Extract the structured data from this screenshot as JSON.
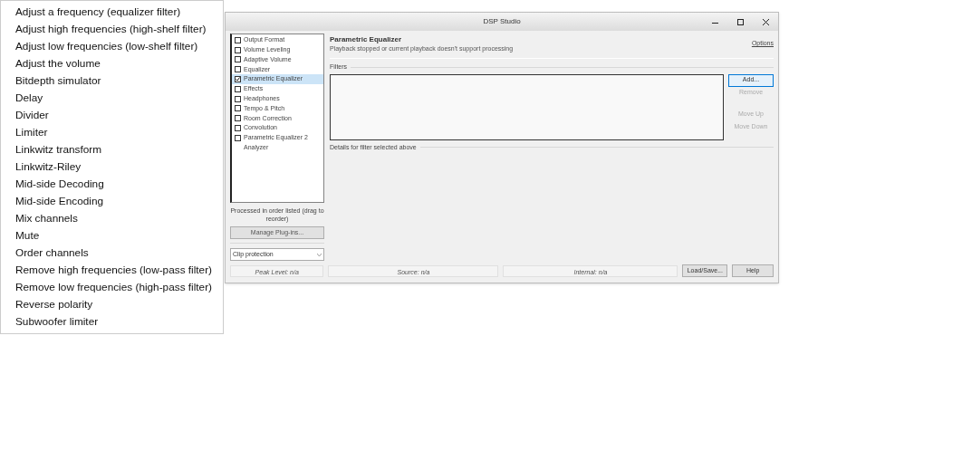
{
  "context_menu": {
    "items": [
      {
        "label": "Adjust a frequency (equalizer filter)"
      },
      {
        "label": "Adjust high frequencies (high-shelf filter)"
      },
      {
        "label": "Adjust low frequencies (low-shelf filter)"
      },
      {
        "label": "Adjust the volume"
      },
      {
        "label": "Bitdepth simulator"
      },
      {
        "label": "Delay"
      },
      {
        "label": "Divider"
      },
      {
        "label": "Limiter"
      },
      {
        "label": "Linkwitz transform"
      },
      {
        "label": "Linkwitz-Riley"
      },
      {
        "label": "Mid-side Decoding"
      },
      {
        "label": "Mid-side Encoding"
      },
      {
        "label": "Mix channels"
      },
      {
        "label": "Mute"
      },
      {
        "label": "Order channels"
      },
      {
        "label": "Remove high frequencies (low-pass filter)"
      },
      {
        "label": "Remove low frequencies (high-pass filter)"
      },
      {
        "label": "Reverse polarity"
      },
      {
        "label": "Subwoofer limiter"
      }
    ]
  },
  "window": {
    "title": "DSP Studio"
  },
  "sidebar": {
    "items": [
      {
        "label": "Output Format",
        "kind": "checkbox",
        "checked": false,
        "selected": false
      },
      {
        "label": "Volume Leveling",
        "kind": "checkbox",
        "checked": false,
        "selected": false
      },
      {
        "label": "Adaptive Volume",
        "kind": "checkbox",
        "checked": false,
        "selected": false
      },
      {
        "label": "Equalizer",
        "kind": "checkbox",
        "checked": false,
        "selected": false
      },
      {
        "label": "Parametric Equalizer",
        "kind": "checkbox",
        "checked": true,
        "selected": true
      },
      {
        "label": "Effects",
        "kind": "checkbox",
        "checked": false,
        "selected": false
      },
      {
        "label": "Headphones",
        "kind": "checkbox",
        "checked": false,
        "selected": false
      },
      {
        "label": "Tempo & Pitch",
        "kind": "checkbox",
        "checked": false,
        "selected": false
      },
      {
        "label": "Room Correction",
        "kind": "checkbox",
        "checked": false,
        "selected": false
      },
      {
        "label": "Convolution",
        "kind": "checkbox",
        "checked": false,
        "selected": false
      },
      {
        "label": "Parametric Equalizer 2",
        "kind": "checkbox",
        "checked": false,
        "selected": false
      },
      {
        "label": "Analyzer",
        "kind": "plain",
        "selected": false
      }
    ],
    "caption": "Processed in order listed (drag to reorder)",
    "manage_button": "Manage Plug-ins...",
    "dropdown": {
      "value": "Clip protection"
    }
  },
  "panel": {
    "title": "Parametric Equalizer",
    "subtitle": "Playback stopped or current playback doesn't support processing",
    "options_link": "Options",
    "filters_group": "Filters",
    "filter_buttons": [
      {
        "label": "Add...",
        "disabled": false,
        "focused": true
      },
      {
        "label": "Remove",
        "disabled": true,
        "focused": false
      },
      {
        "label": "Move Up",
        "disabled": true,
        "focused": false
      },
      {
        "label": "Move Down",
        "disabled": true,
        "focused": false
      }
    ],
    "details_group": "Details for filter selected above"
  },
  "status_bar": {
    "fields": [
      "Peak Level: n/a",
      "Source: n/a",
      "Internal: n/a"
    ],
    "buttons": [
      "Load/Save...",
      "Help"
    ]
  }
}
